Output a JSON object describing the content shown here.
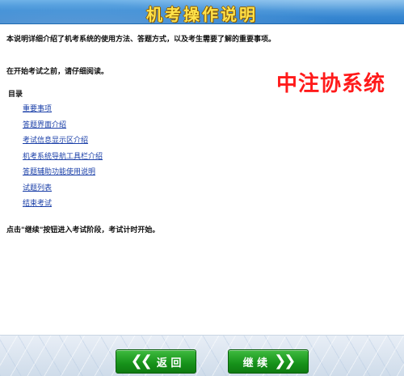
{
  "header": {
    "title": "机考操作说明"
  },
  "content": {
    "intro": "本说明详细介绍了机考系统的使用方法、答题方式，以及考生需要了解的重要事项。",
    "read_note": "在开始考试之前，请仔细阅读。",
    "toc_title": "目录",
    "toc_items": [
      "重要事项",
      "答题界面介绍",
      "考试信息显示区介绍",
      "机考系统导航工具栏介绍",
      "答题辅助功能使用说明",
      "试题列表",
      "结束考试"
    ],
    "footer_note": "点击\"继续\"按钮进入考试阶段，考试计时开始。"
  },
  "watermark": "中注协系统",
  "buttons": {
    "back_label": "返 回",
    "next_label": "继 续",
    "back_icon": "double-chevron-left",
    "next_icon": "double-chevron-right"
  }
}
